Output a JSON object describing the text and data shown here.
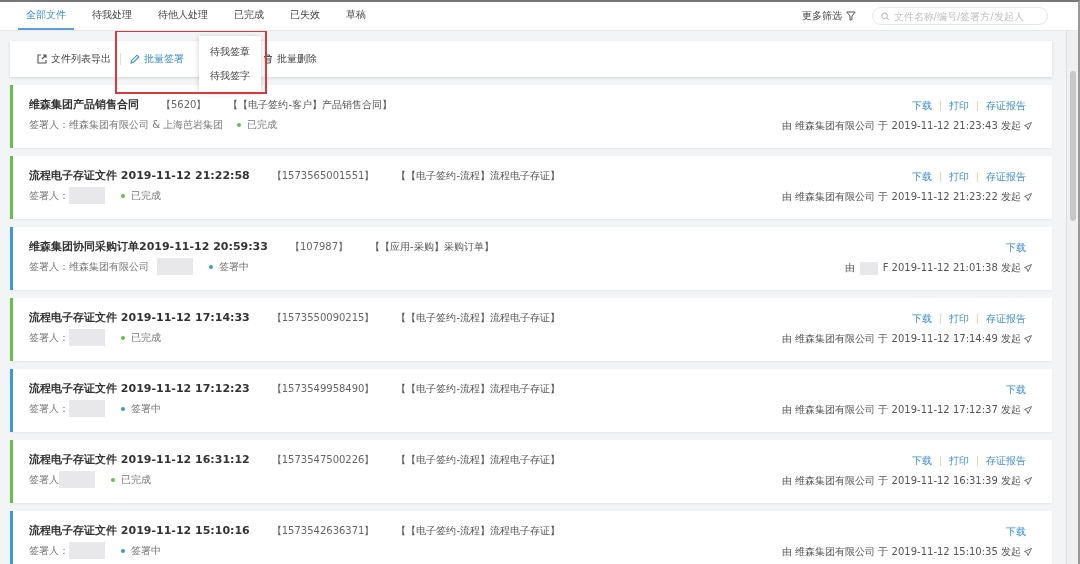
{
  "tabs": [
    {
      "label": "全部文件",
      "selected": true
    },
    {
      "label": "待我处理",
      "selected": false
    },
    {
      "label": "待他人处理",
      "selected": false
    },
    {
      "label": "已完成",
      "selected": false
    },
    {
      "label": "已失效",
      "selected": false
    },
    {
      "label": "草稿",
      "selected": false
    }
  ],
  "filter": {
    "label": "更多筛选"
  },
  "search": {
    "placeholder": "文件名称/编号/签署方/发起人"
  },
  "toolbar": {
    "actions": [
      {
        "kind": "export",
        "label": "文件列表导出",
        "active": false
      },
      {
        "kind": "sign",
        "label": "批量签署",
        "active": true
      },
      {
        "kind": "delete",
        "label": "批量删除",
        "active": false
      }
    ],
    "menu": {
      "items": [
        "待我签章",
        "待我签字"
      ]
    }
  },
  "documents": [
    {
      "title": "维森集团产品销售合同",
      "number": "【5620】",
      "category": "【【电子签约-客户】产品销售合同】",
      "signer_label": "签署人：",
      "signer": [
        {
          "kind": "text",
          "text": "维森集团有限公司 & 上海芭岩集团"
        }
      ],
      "status": "已完成",
      "color": "#6abf4b",
      "actions": [
        "下载",
        "打印",
        "存证报告"
      ],
      "initiator": [
        {
          "kind": "text",
          "text": "由 维森集团有限公司 于 2019-11-12 21:23:43 发起"
        }
      ]
    },
    {
      "title": "流程电子存证文件 2019-11-12 21:22:58",
      "number": "【1573565001551】",
      "category": "【【电子签约-流程】流程电子存证】",
      "signer_label": "签署人：",
      "signer": [
        {
          "kind": "redacted"
        }
      ],
      "status": "已完成",
      "color": "#6abf4b",
      "actions": [
        "下载",
        "打印",
        "存证报告"
      ],
      "initiator": [
        {
          "kind": "text",
          "text": "由 维森集团有限公司 于 2019-11-12 21:23:22 发起"
        }
      ]
    },
    {
      "title": "维森集团协同采购订单2019-11-12 20:59:33",
      "number": "【107987】",
      "category": "【【应用-采购】采购订单】",
      "signer_label": "签署人：",
      "signer": [
        {
          "kind": "text",
          "text": "维森集团有限公司"
        },
        {
          "kind": "redacted"
        }
      ],
      "status": "签署中",
      "color": "#3a9ad9",
      "actions": [
        "下载"
      ],
      "initiator": [
        {
          "kind": "text",
          "text": "由"
        },
        {
          "kind": "redacted"
        },
        {
          "kind": "text",
          "text": "F 2019-11-12 21:01:38 发起"
        }
      ]
    },
    {
      "title": "流程电子存证文件 2019-11-12 17:14:33",
      "number": "【1573550090215】",
      "category": "【【电子签约-流程】流程电子存证】",
      "signer_label": "签署人：",
      "signer": [
        {
          "kind": "redacted"
        }
      ],
      "status": "已完成",
      "color": "#6abf4b",
      "actions": [
        "下载",
        "打印",
        "存证报告"
      ],
      "initiator": [
        {
          "kind": "text",
          "text": "由 维森集团有限公司 于 2019-11-12 17:14:49 发起"
        }
      ]
    },
    {
      "title": "流程电子存证文件 2019-11-12 17:12:23",
      "number": "【1573549958490】",
      "category": "【【电子签约-流程】流程电子存证】",
      "signer_label": "签署人：",
      "signer": [
        {
          "kind": "redacted"
        }
      ],
      "status": "签署中",
      "color": "#3a9ad9",
      "actions": [
        "下载"
      ],
      "initiator": [
        {
          "kind": "text",
          "text": "由 维森集团有限公司 于 2019-11-12 17:12:37 发起"
        }
      ]
    },
    {
      "title": "流程电子存证文件 2019-11-12 16:31:12",
      "number": "【1573547500226】",
      "category": "【【电子签约-流程】流程电子存证】",
      "signer_label": "签署人",
      "signer": [
        {
          "kind": "redacted"
        }
      ],
      "status": "已完成",
      "color": "#6abf4b",
      "actions": [
        "下载",
        "打印",
        "存证报告"
      ],
      "initiator": [
        {
          "kind": "text",
          "text": "由 维森集团有限公司 于 2019-11-12 16:31:39 发起"
        }
      ]
    },
    {
      "title": "流程电子存证文件 2019-11-12 15:10:16",
      "number": "【1573542636371】",
      "category": "【【电子签约-流程】流程电子存证】",
      "signer_label": "签署人：",
      "signer": [
        {
          "kind": "redacted"
        }
      ],
      "status": "签署中",
      "color": "#3a9ad9",
      "actions": [
        "下载"
      ],
      "initiator": [
        {
          "kind": "text",
          "text": "由 维森集团有限公司 于 2019-11-12 15:10:35 发起"
        }
      ]
    }
  ]
}
